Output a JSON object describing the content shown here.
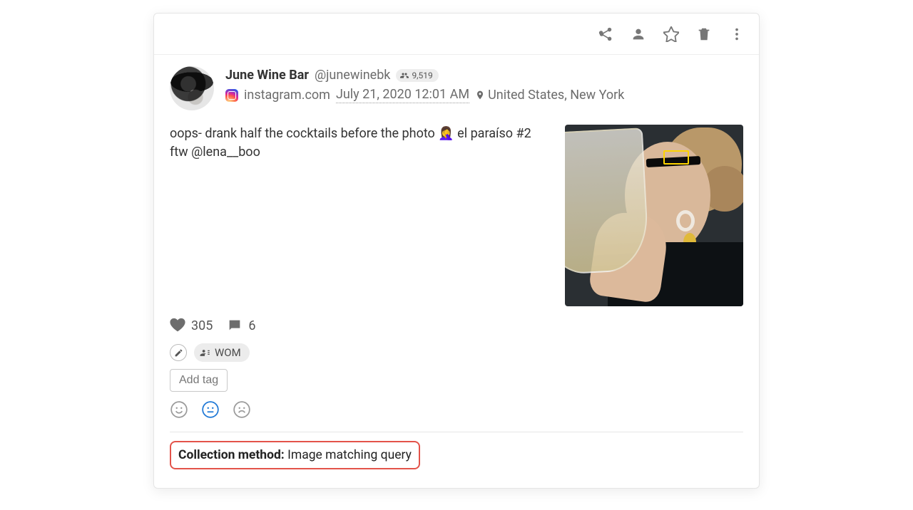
{
  "post": {
    "author_name": "June Wine Bar",
    "handle": "@junewinebk",
    "followers": "9,519",
    "source_domain": "instagram.com",
    "timestamp": "July 21, 2020 12:01 AM",
    "location": "United States, New York",
    "text_part1": "oops- drank half the cocktails before the photo ",
    "text_emoji": "🤦‍♀️",
    "text_part2": "  el paraíso #2 ftw @lena__boo"
  },
  "engagement": {
    "likes": "305",
    "comments": "6"
  },
  "tags": {
    "wom_label": "WOM",
    "add_tag_label": "Add tag"
  },
  "footer": {
    "label": "Collection method:",
    "value": "Image matching query"
  }
}
